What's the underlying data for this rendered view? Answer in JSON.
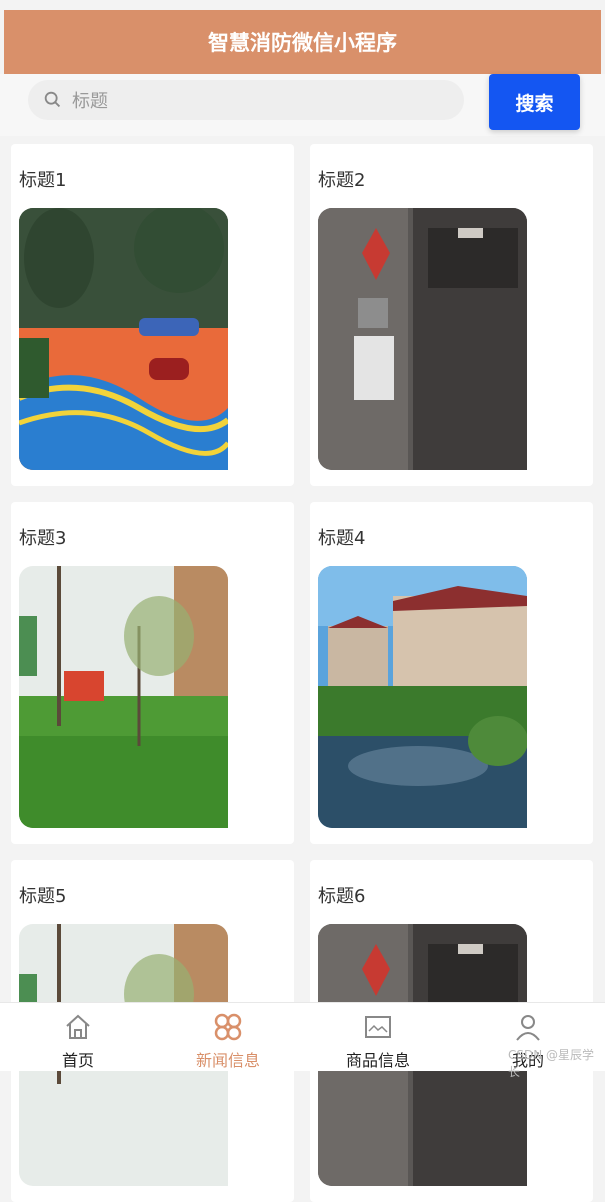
{
  "header": {
    "title": "智慧消防微信小程序"
  },
  "search": {
    "placeholder": "标题",
    "button_label": "搜索"
  },
  "cards": [
    {
      "title": "标题1",
      "image": "playground-photo"
    },
    {
      "title": "标题2",
      "image": "elevator-photo"
    },
    {
      "title": "标题3",
      "image": "park-photo"
    },
    {
      "title": "标题4",
      "image": "villa-photo"
    },
    {
      "title": "标题5",
      "image": "park-photo"
    },
    {
      "title": "标题6",
      "image": "elevator-photo"
    }
  ],
  "tabbar": {
    "items": [
      {
        "label": "首页",
        "icon": "home-icon"
      },
      {
        "label": "新闻信息",
        "icon": "clover-icon",
        "active": true
      },
      {
        "label": "商品信息",
        "icon": "image-icon"
      },
      {
        "label": "我的",
        "icon": "person-icon"
      }
    ],
    "active_color": "#d9906a"
  },
  "watermark": "CSDN @星辰学长",
  "colors": {
    "header": "#d9906a",
    "search_button": "#1456f2"
  }
}
